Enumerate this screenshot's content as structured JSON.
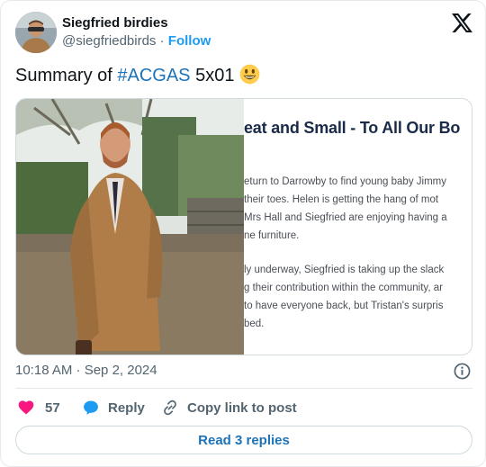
{
  "author": {
    "display_name": "Siegfried birdies",
    "handle": "@siegfriedbirds",
    "separator": "·",
    "follow_label": "Follow"
  },
  "post": {
    "text_prefix": "Summary of ",
    "hashtag": "#ACGAS",
    "text_suffix": " 5x01 ",
    "emoji": "smiling-face-emoji"
  },
  "article_preview": {
    "title": "eat and Small - To All Our Bo",
    "lines": [
      "eturn to Darrowby to find young baby Jimmy",
      "their toes. Helen is getting the hang of mot",
      "Mrs Hall and Siegfried are enjoying having a",
      "ne furniture.",
      "ly underway, Siegfried is taking up the slack",
      "g their contribution within the community, ar",
      "to have everyone back, but Tristan's surpris",
      "bed."
    ]
  },
  "meta": {
    "timestamp": "10:18 AM · Sep 2, 2024"
  },
  "actions": {
    "like_count": "57",
    "reply_label": "Reply",
    "copy_label": "Copy link to post",
    "read_replies_label": "Read 3 replies"
  },
  "colors": {
    "accent": "#1d9bf0",
    "link": "#1d73b8",
    "heart": "#f91880",
    "muted": "#536471"
  },
  "icons": [
    "x-logo-icon",
    "info-icon",
    "heart-icon",
    "reply-bubble-icon",
    "link-icon"
  ]
}
